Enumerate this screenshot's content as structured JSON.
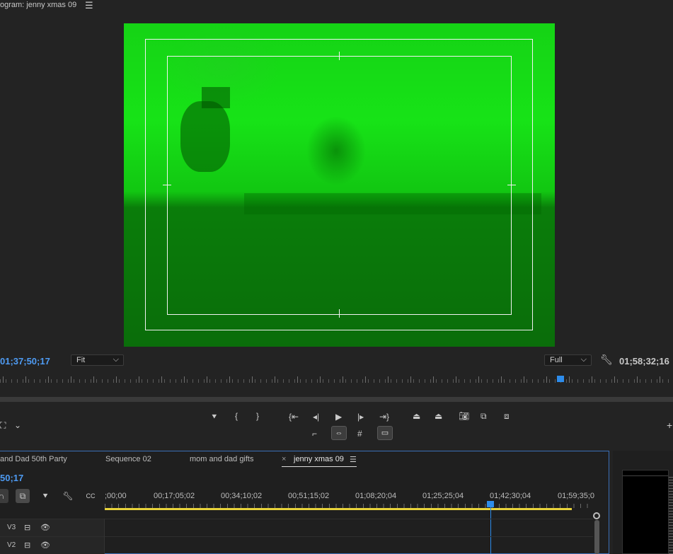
{
  "monitor": {
    "title": "ogram: jenny xmas 09",
    "menu_icon": "hamburger-icon",
    "timecode_current": "01;37;50;17",
    "timecode_duration": "01;58;32;16",
    "zoom_select": "Fit",
    "resolution_select": "Full"
  },
  "transport": {
    "buttons": [
      "add-marker",
      "mark-in",
      "mark-out",
      "go-to-in",
      "step-back",
      "play",
      "step-forward",
      "go-to-out",
      "lift",
      "extract",
      "export-frame",
      "insert",
      "overwrite",
      "trim",
      "toggle-proxies",
      "safe-margins",
      "comparison-view"
    ]
  },
  "timeline": {
    "tabs": [
      {
        "label": "and Dad 50th Party"
      },
      {
        "label": "Sequence 02"
      },
      {
        "label": "mom and dad gifts"
      },
      {
        "label": "jenny xmas 09",
        "active": true,
        "close": "×",
        "menu": "☰"
      }
    ],
    "timecode": "50;17",
    "ruler_labels": [
      ";00;00",
      "00;17;05;02",
      "00;34;10;02",
      "00;51;15;02",
      "01;08;20;04",
      "01;25;25;04",
      "01;42;30;04",
      "01;59;35;0"
    ],
    "tracks": [
      {
        "name": "V3"
      },
      {
        "name": "V2"
      }
    ]
  },
  "colors": {
    "accent": "#4e9bf3",
    "playhead": "#2d8ceb",
    "work_area": "#e7d23a",
    "frame_green": "#17e317"
  }
}
